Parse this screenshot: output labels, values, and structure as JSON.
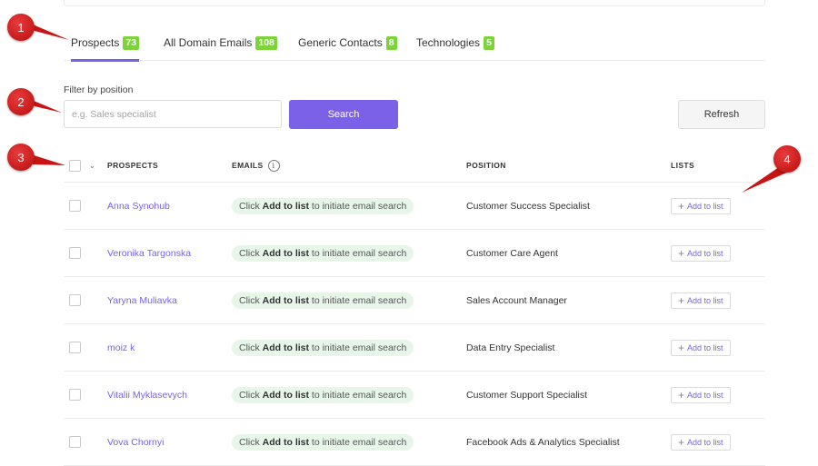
{
  "tabs": [
    {
      "label": "Prospects",
      "count": "73"
    },
    {
      "label": "All Domain Emails",
      "count": "108"
    },
    {
      "label": "Generic Contacts",
      "count": "8"
    },
    {
      "label": "Technologies",
      "count": "5"
    }
  ],
  "filter": {
    "label": "Filter by position",
    "placeholder": "e.g. Sales specialist",
    "search_label": "Search",
    "refresh_label": "Refresh"
  },
  "table": {
    "headers": {
      "prospects": "PROSPECTS",
      "emails": "EMAILS",
      "position": "POSITION",
      "lists": "LISTS"
    },
    "email_prefix": "Click",
    "email_bold": "Add to list",
    "email_suffix": "to initiate email search",
    "add_label": "Add to list",
    "rows": [
      {
        "name": "Anna Synohub",
        "position": "Customer Success Specialist"
      },
      {
        "name": "Veronika Targonska",
        "position": "Customer Care Agent"
      },
      {
        "name": "Yaryna Muliavka",
        "position": "Sales Account Manager"
      },
      {
        "name": "moiz k",
        "position": "Data Entry Specialist"
      },
      {
        "name": "Vitalii Myklasevych",
        "position": "Customer Support Specialist"
      },
      {
        "name": "Vova Chornyi",
        "position": "Facebook Ads & Analytics Specialist"
      }
    ]
  },
  "markers": [
    "1",
    "2",
    "3",
    "4"
  ],
  "colors": {
    "accent": "#7b61e8",
    "badge": "#7cd33a",
    "marker": "#c91414",
    "email_pill": "#e8f6ea"
  }
}
